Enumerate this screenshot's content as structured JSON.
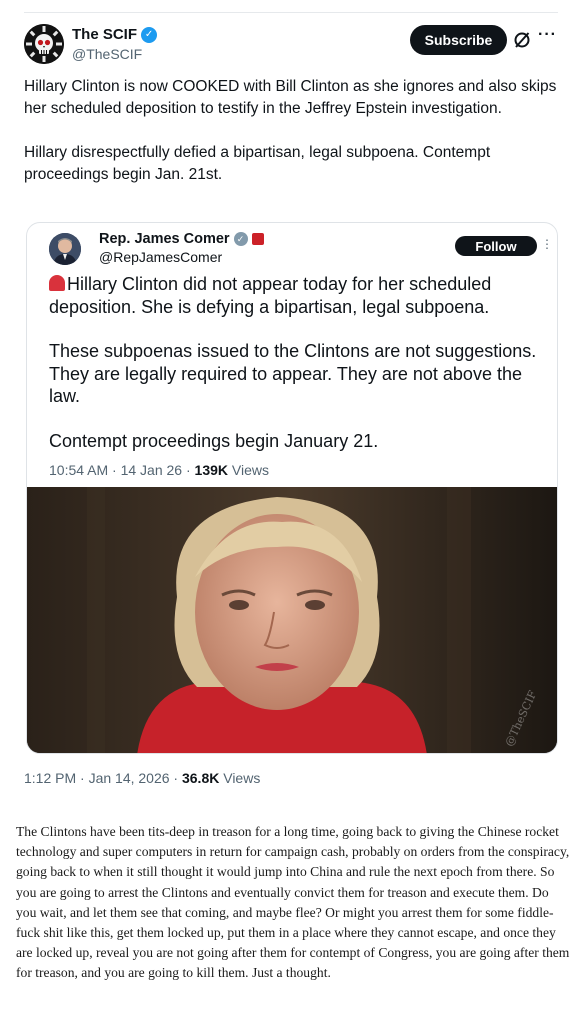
{
  "outer_tweet": {
    "display_name": "The SCIF",
    "handle": "@TheSCIF",
    "subscribe_label": "Subscribe",
    "more_label": "···",
    "paragraphs": [
      "Hillary Clinton is now COOKED with Bill Clinton as she ignores and also skips her scheduled deposition to testify in the Jeffrey Epstein investigation.",
      "Hillary disrespectfully defied a bipartisan, legal subpoena. Contempt proceedings begin Jan. 21st."
    ],
    "timestamp": "1:12 PM · Jan 14, 2026 · ",
    "views_count": "36.8K",
    "views_label": " Views"
  },
  "quoted_tweet": {
    "display_name": "Rep. James Comer",
    "handle": "@RepJamesComer",
    "follow_label": "Follow",
    "more_label": "⋮",
    "paragraphs": [
      "Hillary Clinton did not appear today for her scheduled deposition. She is defying a bipartisan, legal subpoena.",
      "These subpoenas issued to the Clintons are not suggestions. They are legally required to appear. They are not above the law.",
      "Contempt proceedings begin January 21."
    ],
    "timestamp": "10:54 AM · 14 Jan 26 · ",
    "views_count": "139K",
    "views_label": " Views"
  },
  "photo": {
    "watermark": "@TheSCIF"
  },
  "comment": {
    "text": "The Clintons have been tits-deep in treason for a long time, going back to giving the Chinese rocket technology and super computers in return for campaign cash, probably on orders from the conspiracy, going back to when it still thought it would jump into China and rule the next epoch from there. So you are going to arrest the Clintons and eventually convict them for treason and execute them. Do you wait, and let them see that coming, and maybe flee? Or might you arrest them for some fiddle-fuck shit like this, get them locked up, put them in a place where they cannot escape, and once they are locked up, reveal you are not going after them for contempt of Congress, you are going after them for treason, and you are going to kill them. Just a thought."
  },
  "colors": {
    "verified_blue": "#1d9bf0",
    "text_primary": "#0f1419",
    "text_secondary": "#536471",
    "button_dark": "#0f1419"
  }
}
